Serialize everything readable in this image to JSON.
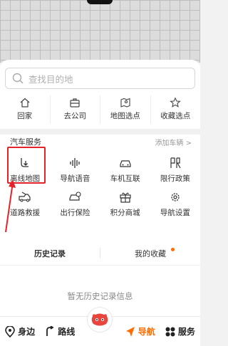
{
  "search": {
    "placeholder": "查找目的地"
  },
  "quick_actions": [
    {
      "label": "回家",
      "icon": "home-icon"
    },
    {
      "label": "去公司",
      "icon": "briefcase-icon"
    },
    {
      "label": "地图选点",
      "icon": "map-pin-icon"
    },
    {
      "label": "收藏选点",
      "icon": "star-icon"
    }
  ],
  "car_service": {
    "title": "汽车服务",
    "add_vehicle": "添加车辆 >",
    "items": [
      {
        "label": "离线地图",
        "icon": "offline-map-icon"
      },
      {
        "label": "导航语音",
        "icon": "voice-wave-icon"
      },
      {
        "label": "车机互联",
        "icon": "car-connect-icon"
      },
      {
        "label": "限行政策",
        "icon": "restriction-icon"
      },
      {
        "label": "道路救援",
        "icon": "tow-truck-icon"
      },
      {
        "label": "出行保险",
        "icon": "insurance-car-icon"
      },
      {
        "label": "积分商城",
        "icon": "gift-icon"
      },
      {
        "label": "导航设置",
        "icon": "settings-gear-icon"
      }
    ]
  },
  "tabs": [
    {
      "label": "历史记录",
      "active": true
    },
    {
      "label": "我的收藏",
      "active": false,
      "badge_dot": true
    }
  ],
  "empty_state": {
    "text": "暂无历史记录信息"
  },
  "bottom_nav": [
    {
      "label": "身边",
      "icon": "location-pin-icon"
    },
    {
      "label": "路线",
      "icon": "route-icon"
    },
    {
      "label": "导航",
      "icon": "navigation-arrow-icon",
      "active": true
    },
    {
      "label": "服务",
      "icon": "grid-icon"
    }
  ],
  "colors": {
    "accent": "#ff6d00",
    "annotation_red": "#e3222a"
  }
}
